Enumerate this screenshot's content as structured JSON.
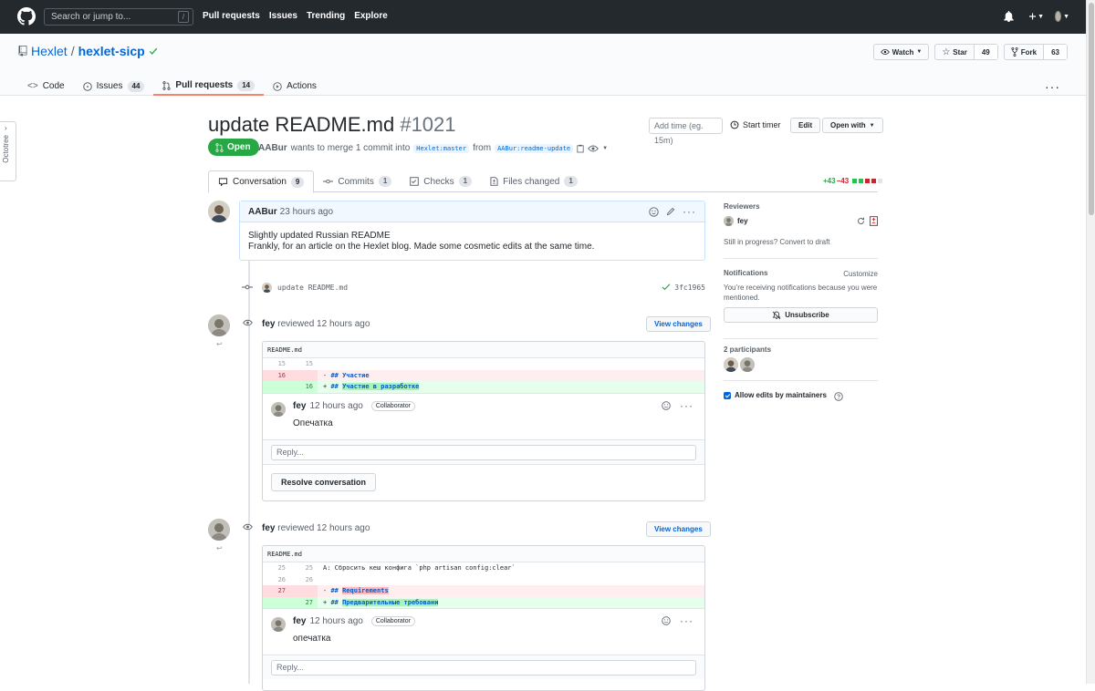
{
  "header": {
    "search_placeholder": "Search or jump to...",
    "search_key": "/",
    "nav": [
      "Pull requests",
      "Issues",
      "Trending",
      "Explore"
    ]
  },
  "repo": {
    "owner": "Hexlet",
    "name": "hexlet-sicp",
    "watch_label": "Watch",
    "star_label": "Star",
    "star_count": "49",
    "fork_label": "Fork",
    "fork_count": "63",
    "tabs": [
      {
        "label": "Code",
        "count": ""
      },
      {
        "label": "Issues",
        "count": "44"
      },
      {
        "label": "Pull requests",
        "count": "14"
      },
      {
        "label": "Actions",
        "count": ""
      }
    ]
  },
  "octotree": {
    "label": "Octotree"
  },
  "pr": {
    "title": "update README.md",
    "number": "#1021",
    "time_placeholder": "Add time (eg. 15m)",
    "start_timer": "Start timer",
    "edit_label": "Edit",
    "open_with_label": "Open with",
    "state": "Open",
    "author": "AABur",
    "meta_text": "wants to merge 1 commit into",
    "base_branch": "Hexlet:master",
    "from_text": "from",
    "head_branch": "AABur:readme-update",
    "tabs": [
      {
        "label": "Conversation",
        "count": "9"
      },
      {
        "label": "Commits",
        "count": "1"
      },
      {
        "label": "Checks",
        "count": "1"
      },
      {
        "label": "Files changed",
        "count": "1"
      }
    ],
    "additions": "+43",
    "deletions": "−43"
  },
  "comment": {
    "author": "AABur",
    "time": "23 hours ago",
    "line1": "Slightly updated Russian README",
    "line2": "Frankly, for an article on the Hexlet blog. Made some cosmetic edits at the same time."
  },
  "commit": {
    "message": "update README.md",
    "sha": "3fc1965"
  },
  "reviews": [
    {
      "author": "fey",
      "text": "reviewed",
      "time": "12 hours ago",
      "view_changes": "View changes",
      "file": "README.md",
      "lines": [
        {
          "type": "ctx",
          "n1": "15",
          "n2": "15",
          "code": ""
        },
        {
          "type": "del",
          "n1": "16",
          "n2": "",
          "code": "Участие"
        },
        {
          "type": "add",
          "n1": "",
          "n2": "16",
          "code": "Участие в разработке"
        }
      ],
      "inline_author": "fey",
      "inline_time": "12 hours ago",
      "badge": "Collaborator",
      "inline_body": "Опечатка",
      "reply_placeholder": "Reply...",
      "resolve_label": "Resolve conversation"
    },
    {
      "author": "fey",
      "text": "reviewed",
      "time": "12 hours ago",
      "view_changes": "View changes",
      "file": "README.md",
      "lines": [
        {
          "type": "ctx",
          "n1": "25",
          "n2": "25",
          "code": "A: Сбросить кеш конфига `php artisan config:clear`"
        },
        {
          "type": "ctx",
          "n1": "26",
          "n2": "26",
          "code": ""
        },
        {
          "type": "del",
          "n1": "27",
          "n2": "",
          "code": "Requirements"
        },
        {
          "type": "add",
          "n1": "",
          "n2": "27",
          "code": "Предварительные требовани"
        }
      ],
      "inline_author": "fey",
      "inline_time": "12 hours ago",
      "badge": "Collaborator",
      "inline_body": "опечатка",
      "reply_placeholder": "Reply..."
    }
  ],
  "sidebar": {
    "reviewers_title": "Reviewers",
    "reviewer": "fey",
    "draft_text": "Still in progress?",
    "draft_link": "Convert to draft",
    "notifications_title": "Notifications",
    "customize": "Customize",
    "notif_text": "You’re receiving notifications because you were mentioned.",
    "unsubscribe": "Unsubscribe",
    "participants_title": "2 participants",
    "allow_edits": "Allow edits by maintainers"
  },
  "colors": {
    "header_bg": "#24292e",
    "open_green": "#28a745",
    "link_blue": "#0366d6",
    "tab_accent": "#f9826c"
  }
}
